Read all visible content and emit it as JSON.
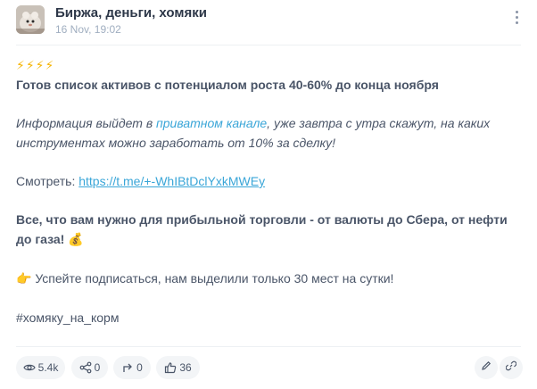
{
  "channel": {
    "name": "Биржа, деньги, хомяки",
    "date": "16 Nov, 19:02"
  },
  "post": {
    "emoji_line": "⚡⚡⚡⚡",
    "headline": "Готов список активов с потенциалом роста 40-60% до конца ноября",
    "info_before": "Информация выйдет в ",
    "info_link": "приватном канале",
    "info_after": ", уже завтра с утра скажут, на каких инструментах можно заработать от 10% за сделку!",
    "watch_label": "Смотреть: ",
    "watch_url": "https://t.me/+-WhIBtDclYxkMWEy",
    "promo": "Все, что вам нужно для прибыльной торговли - от валюты до Сбера, от нефти до газа!",
    "promo_emoji": "💰",
    "cta_emoji": "👉",
    "cta": " Успейте подписаться, нам выделили только 30 мест на сутки!",
    "hashtag": "#хомяку_на_корм"
  },
  "stats": {
    "views": "5.4k",
    "shares": "0",
    "forwards": "0",
    "likes": "36"
  },
  "icons": {
    "views": "eye-icon",
    "shares": "share-icon",
    "forwards": "forward-arrow-icon",
    "likes": "thumbs-up-icon",
    "edit": "pencil-icon",
    "link": "link-icon",
    "more": "more-vertical-icon"
  },
  "colors": {
    "link": "#3aa6d8",
    "text": "#4a5568",
    "muted": "#a0aec0",
    "pill_bg": "#f3f5f7"
  }
}
